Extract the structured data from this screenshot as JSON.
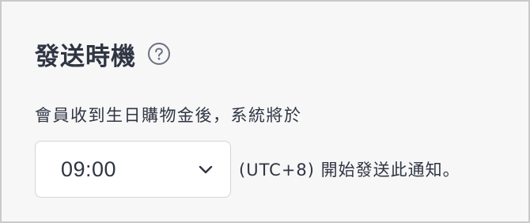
{
  "section": {
    "title": "發送時機",
    "help_icon": "question-circle-icon"
  },
  "description": "會員收到生日購物金後，系統將於",
  "time_select": {
    "selected_value": "09:00",
    "chevron_icon": "chevron-down-icon"
  },
  "suffix_text": "(UTC+8) 開始發送此通知。",
  "colors": {
    "text": "#2f3542",
    "background": "#f7f7f8",
    "select_border": "#d0d4da",
    "icon": "#6b7280"
  }
}
